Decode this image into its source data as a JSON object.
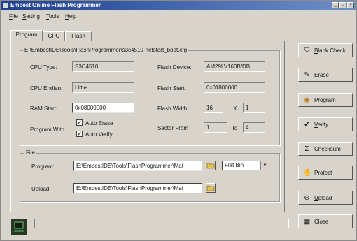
{
  "window": {
    "title": "Embest Online Flash Programmer"
  },
  "title_controls": {
    "minimize": "_",
    "maximize": "□",
    "close": "×"
  },
  "menu": [
    {
      "hot": "F",
      "rest": "ile"
    },
    {
      "hot": "S",
      "rest": "etting"
    },
    {
      "hot": "T",
      "rest": "ools"
    },
    {
      "hot": "H",
      "rest": "elp"
    }
  ],
  "tabs": [
    "Program",
    "CPU",
    "Flash"
  ],
  "config_path": "E:\\EmbestIDE\\Tools\\FlashProgrammer\\s3c4510-netstart_boot.cfg",
  "labels": {
    "cpu_type": "CPU Type:",
    "cpu_endian": "CPU Endian:",
    "ram_start": "RAM Start:",
    "program_with": "Program With",
    "flash_device": "Flash Device:",
    "flash_start": "Flash Start:",
    "flash_width": "Flash Width:",
    "sector_from": "Sector From",
    "x": "X",
    "to": "To"
  },
  "values": {
    "cpu_type": "S3C4510",
    "cpu_endian": "Little",
    "ram_start": "0x08000000",
    "flash_device": "AM29LV160B/DB",
    "flash_start": "0x01800000",
    "flash_width_a": "16",
    "flash_width_b": "1",
    "sector_from": "1",
    "sector_to": "4"
  },
  "checkboxes": {
    "auto_erase": {
      "label": "Auto Erase",
      "checked": true
    },
    "auto_verify": {
      "label": "Auto Verify",
      "checked": true
    }
  },
  "file_group": {
    "legend": "File",
    "program_label": "Program:",
    "program_path": "E:\\EmbestIDE\\Tools\\FlashProgrammer\\Mat",
    "upload_label": "Upload:",
    "upload_path": "E:\\EmbestIDE\\Tools\\FlashProgrammer\\Mat",
    "format_selected": "Flat Bin"
  },
  "side_buttons": [
    {
      "hot": "B",
      "rest": "lank Check",
      "icon": "shield-icon",
      "glyph": "⛉"
    },
    {
      "hot": "E",
      "rest": "rase",
      "icon": "pencil-icon",
      "glyph": "✎"
    },
    {
      "hot": "P",
      "rest": "rogram",
      "icon": "program-icon",
      "glyph": "◉"
    },
    {
      "hot": "V",
      "rest": "erify",
      "icon": "check-icon",
      "glyph": "✔"
    },
    {
      "hot": "C",
      "rest": "hecksum",
      "icon": "sigma-icon",
      "glyph": "Σ"
    },
    {
      "hot": "",
      "rest": "Protect",
      "icon": "protect-icon",
      "glyph": "✋"
    },
    {
      "hot": "U",
      "rest": "pload",
      "icon": "upload-icon",
      "glyph": "⊕"
    },
    {
      "hot": "",
      "rest": "Close",
      "icon": "close-icon",
      "glyph": "▦"
    }
  ],
  "colors": {
    "titlebar_start": "#1c3f93",
    "titlebar_end": "#6f8fc8",
    "face": "#d8d4cc"
  }
}
